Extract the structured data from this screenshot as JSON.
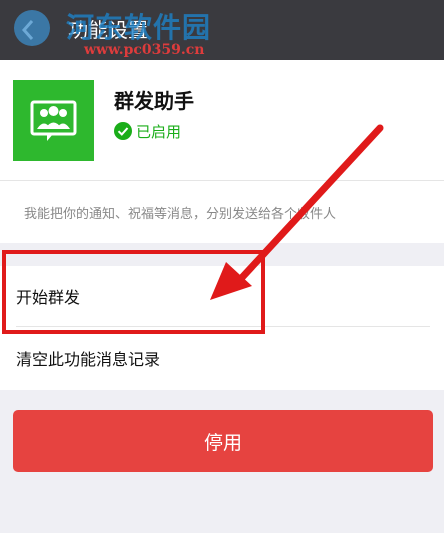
{
  "header": {
    "title": "功能设置",
    "back_icon": "chevron-left-icon"
  },
  "watermark": {
    "title": "河东软件园",
    "url": "www.pc0359.cn"
  },
  "app": {
    "name": "群发助手",
    "icon": "group-chat-icon",
    "status_icon": "check-circle-icon",
    "status_text": "已启用",
    "description": "我能把你的通知、祝福等消息，分别发送给各个收件人"
  },
  "menu": {
    "items": [
      {
        "label": "开始群发"
      },
      {
        "label": "清空此功能消息记录"
      }
    ]
  },
  "actions": {
    "disable_label": "停用"
  },
  "colors": {
    "topbar": "#3a3a3f",
    "app_icon": "#2eb82e",
    "status": "#1aad19",
    "disable_button": "#e64340",
    "annotation": "#e01a1a"
  }
}
